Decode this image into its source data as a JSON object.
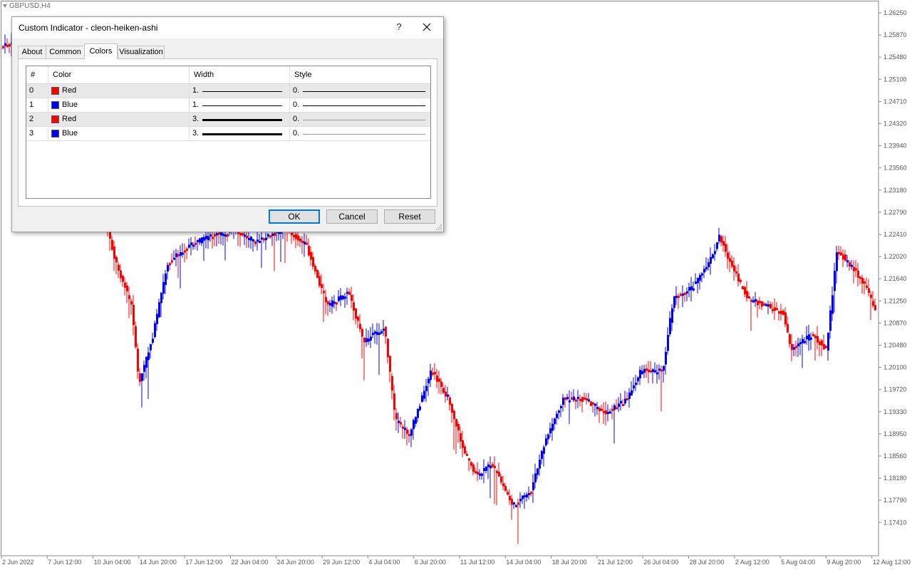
{
  "chart": {
    "symbol": "GBPUSD,H4",
    "bull_color": "#0000ff",
    "bear_color": "#ff0000",
    "price_ticks": [
      "1.26250",
      "1.25870",
      "1.25480",
      "1.25100",
      "1.24710",
      "1.24320",
      "1.23940",
      "1.23560",
      "1.23180",
      "1.22790",
      "1.22410",
      "1.22020",
      "1.21640",
      "1.21250",
      "1.20870",
      "1.20480",
      "1.20100",
      "1.19720",
      "1.19330",
      "1.18950",
      "1.18560",
      "1.18180",
      "1.17790",
      "1.17410"
    ],
    "time_ticks": [
      "2 Jun 2022",
      "7 Jun 12:00",
      "10 Jun 04:00",
      "14 Jun 20:00",
      "17 Jun 12:00",
      "22 Jun 04:00",
      "24 Jun 20:00",
      "29 Jun 12:00",
      "4 Jul 04:00",
      "6 Jul 20:00",
      "11 Jul 12:00",
      "14 Jul 04:00",
      "18 Jul 20:00",
      "21 Jul 12:00",
      "26 Jul 04:00",
      "28 Jul 20:00",
      "2 Aug 12:00",
      "5 Aug 04:00",
      "9 Aug 20:00",
      "12 Aug 12:00"
    ]
  },
  "dialog": {
    "title": "Custom Indicator - cleon-heiken-ashi",
    "help_label": "?",
    "tabs": [
      {
        "label": "About"
      },
      {
        "label": "Common"
      },
      {
        "label": "Colors"
      },
      {
        "label": "Visualization"
      }
    ],
    "active_tab": "Colors",
    "table": {
      "headers": [
        "#",
        "Color",
        "Width",
        "Style"
      ],
      "rows": [
        {
          "index": "0",
          "color_name": "Red",
          "color": "#ff0000",
          "width": "1.",
          "style": "0."
        },
        {
          "index": "1",
          "color_name": "Blue",
          "color": "#0000ff",
          "width": "1.",
          "style": "0."
        },
        {
          "index": "2",
          "color_name": "Red",
          "color": "#ff0000",
          "width": "3.",
          "style": "0."
        },
        {
          "index": "3",
          "color_name": "Blue",
          "color": "#0000ff",
          "width": "3.",
          "style": "0."
        }
      ]
    },
    "buttons": {
      "ok": "OK",
      "cancel": "Cancel",
      "reset": "Reset"
    }
  }
}
